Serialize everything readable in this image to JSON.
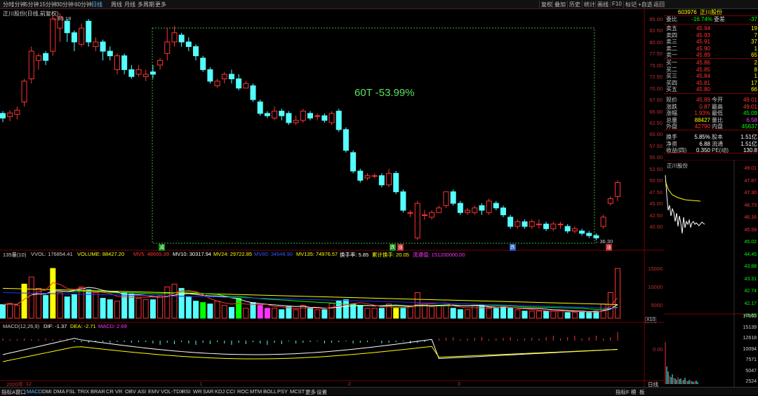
{
  "toolbar": {
    "periods": [
      "分时",
      "1分钟",
      "5分钟",
      "15分钟",
      "30分钟",
      "60分钟",
      "日线",
      "周线",
      "月线",
      "多周期",
      "更多"
    ],
    "active_period": "日线",
    "right_buttons": [
      "复权",
      "叠加",
      "历史",
      "统计",
      "画线",
      "F10",
      "标记",
      "+自选",
      "返回"
    ]
  },
  "chart_title": "正川股份(日线,前复权)",
  "colors": {
    "up": "#ff3232",
    "down": "#54ffff",
    "bg": "#000000",
    "axis": "#c03030",
    "ma_white": "#ffffff",
    "ma_yellow": "#ffff00",
    "ma_green": "#00ff00",
    "ma_blue": "#2233ff"
  },
  "price_axis": [
    "85.00",
    "82.50",
    "80.00",
    "77.50",
    "75.00",
    "72.50",
    "70.00",
    "67.50",
    "65.00",
    "62.50",
    "60.00",
    "57.50",
    "55.00",
    "52.50",
    "50.00",
    "47.50",
    "45.00",
    "42.50",
    "40.00"
  ],
  "annotation_text": "60T -53.99%",
  "high_label": "85.18",
  "low_label": "36.30",
  "markers": {
    "m1": "减",
    "m2": "跌",
    "m3": "涨",
    "m4": "跌",
    "m5": "涨"
  },
  "volume_legend": {
    "count": "135量(10)",
    "vvol": "VVOL: 176854.41",
    "volume": "VOLUME: 88427.20",
    "mv5": "MV5: 48665.39",
    "mv10": "MV10: 30317.94",
    "mv24": "MV24: 29722.85",
    "mv60": "MV60: 34648.90",
    "mv135": "MV135: 74976.57",
    "turnover": "换手率: 5.85",
    "cum_turnover": "累计换手: 20.05",
    "float": "流通值: 151200000.00"
  },
  "volume_axis": [
    "15000",
    "10000",
    "5000"
  ],
  "volume_unit": "X10",
  "macd_legend": {
    "name": "MACD(12,26,9)",
    "dif": "DIF: -1.37",
    "dea": "DEA: -2.71",
    "macd": "MACD: 2.69"
  },
  "macd_axis": [
    "0.00"
  ],
  "date_axis": [
    {
      "label": "2020年",
      "pos": 0.01
    },
    {
      "label": "12",
      "pos": 0.04
    },
    {
      "label": "1",
      "pos": 0.31
    },
    {
      "label": "2",
      "pos": 0.54
    },
    {
      "label": "3",
      "pos": 0.71
    }
  ],
  "bottom_tabs": [
    "指标A",
    "窗口",
    "MACD",
    "DMI",
    "DMA",
    "FSL",
    "TRIX",
    "BRAR",
    "CR",
    "VR",
    "OBV",
    "ASI",
    "EMV",
    "VOL-TDX",
    "RSI",
    "WR",
    "SAR",
    "KDJ",
    "CCI",
    "ROC",
    "MTM",
    "BOLL",
    "PSY",
    "MCST",
    "更多",
    "设置"
  ],
  "bottom_active": "MACD",
  "bottom_right": [
    "指标F",
    "模",
    "板"
  ],
  "quote": {
    "code": "603976",
    "name": "正川股份",
    "weibi_label": "委比",
    "weibi": "-16.74%",
    "weicha_label": "委差",
    "weicha": "-37",
    "sells": [
      {
        "label": "卖五",
        "price": "45.94",
        "vol": "19"
      },
      {
        "label": "卖四",
        "price": "45.93",
        "vol": "7"
      },
      {
        "label": "卖三",
        "price": "45.91",
        "vol": "37"
      },
      {
        "label": "卖二",
        "price": "45.90",
        "vol": "1"
      },
      {
        "label": "卖一",
        "price": "45.89",
        "vol": "65"
      }
    ],
    "buys": [
      {
        "label": "买一",
        "price": "45.86",
        "vol": "2"
      },
      {
        "label": "买二",
        "price": "45.85",
        "vol": "8"
      },
      {
        "label": "买三",
        "price": "45.84",
        "vol": "1"
      },
      {
        "label": "买四",
        "price": "45.81",
        "vol": "17"
      },
      {
        "label": "买五",
        "price": "45.80",
        "vol": "66"
      }
    ],
    "stats": [
      {
        "l1": "现价",
        "v1": "45.89",
        "l2": "今开",
        "v2": "49.01"
      },
      {
        "l1": "涨跌",
        "v1": "0.87",
        "l2": "最高",
        "v2": "49.01"
      },
      {
        "l1": "涨幅",
        "v1": "1.93%",
        "l2": "最低",
        "v2": "45.09"
      },
      {
        "l1": "总量",
        "v1": "88427",
        "l2": "量比",
        "v2": "6.58"
      },
      {
        "l1": "外盘",
        "v1": "42790",
        "l2": "内盘",
        "v2": "45637"
      },
      {
        "l1": "换手",
        "v1": "5.85%",
        "l2": "股本",
        "v2": "1.51亿"
      },
      {
        "l1": "净资",
        "v1": "6.88",
        "l2": "流通",
        "v2": "1.51亿"
      },
      {
        "l1": "收益(四)",
        "v1": "0.350",
        "l2": "PE(动)",
        "v2": "130.8"
      }
    ]
  },
  "mini": {
    "name": "正川股份",
    "left_axis": [
      "49.01",
      "47.87",
      "47.30",
      "46.73",
      "46.16",
      "45.59",
      "45.02",
      "44.45",
      "43.88",
      "43.31",
      "42.74",
      "42.17",
      "41.60"
    ],
    "vol_axis": [
      "17665",
      "15139",
      "12618",
      "10094",
      "7571",
      "5047",
      "2524"
    ],
    "tab": "日线"
  }
}
